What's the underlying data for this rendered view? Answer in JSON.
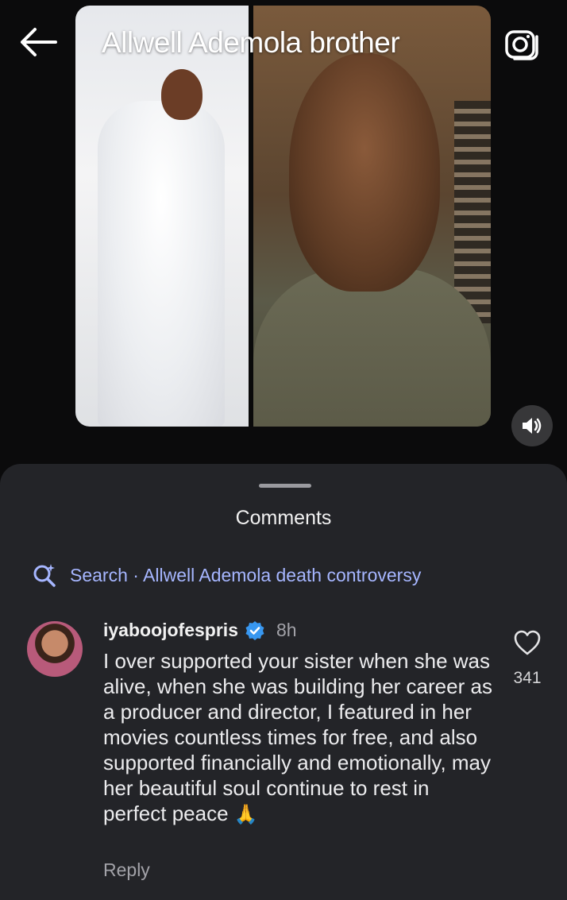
{
  "video": {
    "title": "Allwell Ademola brother"
  },
  "icons": {
    "back": "arrow-left-icon",
    "camera": "camera-icon",
    "sound": "speaker-icon",
    "search": "search-sparkle-icon",
    "verified": "verified-badge-icon",
    "like": "heart-icon"
  },
  "comments_sheet": {
    "title": "Comments",
    "search_label": "Search · Allwell Ademola death controversy",
    "comment": {
      "username": "iyaboojofespris",
      "time": "8h",
      "text": "I over supported your sister when she was alive, when she was building her career as a producer and director, I featured in her movies countless times for free, and also supported financially and emotionally, may her beautiful soul continue to rest in perfect peace",
      "emoji": "🙏",
      "likes": "341",
      "reply_label": "Reply"
    }
  },
  "colors": {
    "background": "#0b0b0c",
    "sheet": "#232428",
    "search_accent": "#a6b6ff",
    "verified": "#3897f0"
  }
}
